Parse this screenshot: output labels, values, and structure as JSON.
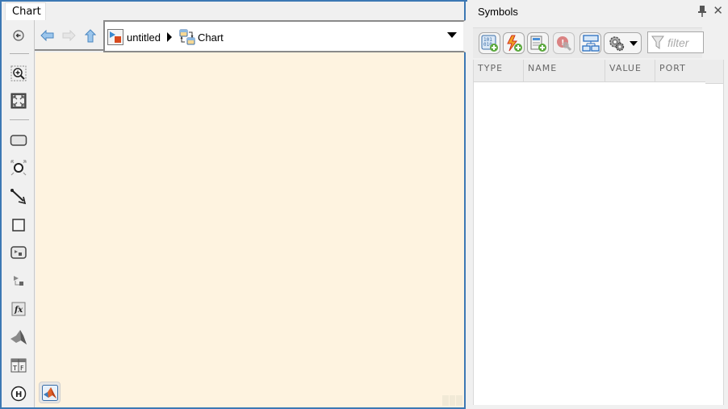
{
  "editor": {
    "tab_label": "Chart",
    "nav": {
      "back_icon": "arrow-left-icon",
      "forward_icon": "arrow-right-icon",
      "up_icon": "arrow-up-icon"
    },
    "breadcrumb": [
      {
        "label": "untitled",
        "icon": "simulink-model-icon"
      },
      {
        "label": "Chart",
        "icon": "stateflow-chart-icon"
      }
    ],
    "left_toolbar": [
      "hide-show-icon",
      "zoom-in-icon",
      "fit-to-view-icon",
      "state-icon",
      "junction-icon",
      "default-transition-icon",
      "box-icon",
      "simulink-function-icon",
      "simulink-state-icon",
      "graphical-function-icon",
      "matlab-function-icon",
      "truth-table-icon",
      "history-junction-icon"
    ],
    "bottom_button_icon": "matlab-logo-icon"
  },
  "symbols": {
    "title": "Symbols",
    "toolbar": [
      {
        "name": "add-data-button",
        "icon": "add-data-icon"
      },
      {
        "name": "add-event-button",
        "icon": "add-event-icon"
      },
      {
        "name": "add-message-button",
        "icon": "add-message-icon"
      },
      {
        "name": "resolve-undefined-button",
        "icon": "resolve-icon"
      },
      {
        "name": "hierarchy-button",
        "icon": "hierarchy-icon"
      },
      {
        "name": "settings-dropdown-button",
        "icon": "gear-icon"
      }
    ],
    "filter": {
      "placeholder": "filter",
      "value": ""
    },
    "columns": [
      "TYPE",
      "NAME",
      "VALUE",
      "PORT"
    ],
    "rows": []
  }
}
